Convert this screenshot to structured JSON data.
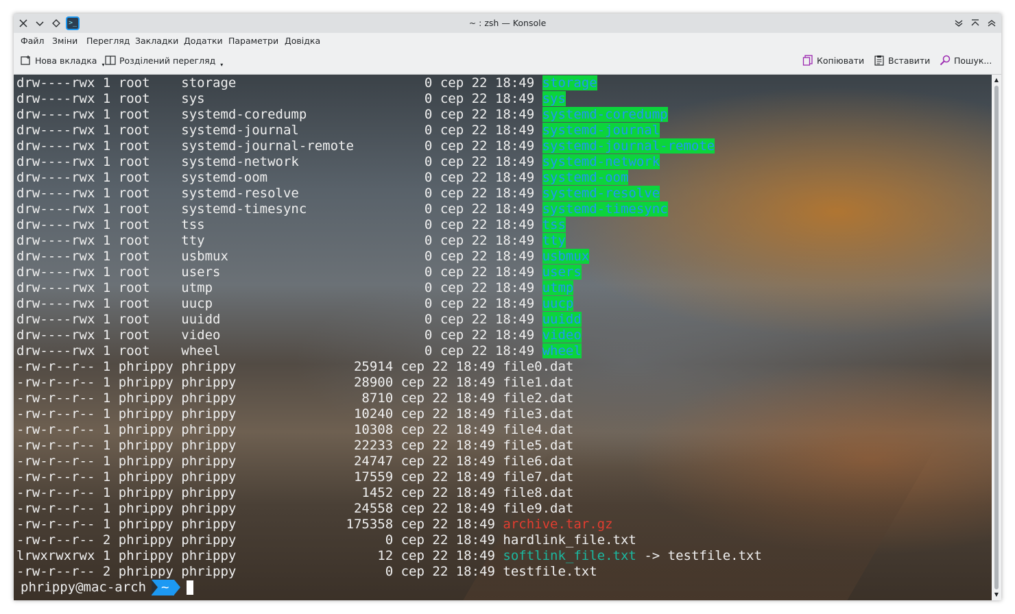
{
  "window": {
    "title": "~ : zsh — Konsole",
    "buttons": {
      "close": "✕",
      "menu": "⌄",
      "keep": "◇",
      "minimize": "⌄",
      "maximize": "⌃",
      "shade": "⌃"
    }
  },
  "menubar": [
    "Файл",
    "Зміни",
    "Перегляд",
    "Закладки",
    "Додатки",
    "Параметри",
    "Довідка"
  ],
  "toolbar": {
    "new_tab": "Нова вкладка",
    "split_view": "Розділений перегляд",
    "copy": "Копіювати",
    "paste": "Вставити",
    "search": "Пошук..."
  },
  "terminal": {
    "lines": [
      {
        "perm": "drw----rwx",
        "links": "1",
        "owner": "root",
        "group": "",
        "target": "storage",
        "size": "0",
        "month": "сер",
        "day": "22",
        "time": "18:49",
        "name": "storage"
      },
      {
        "perm": "drw----rwx",
        "links": "1",
        "owner": "root",
        "group": "",
        "target": "sys",
        "size": "0",
        "month": "сер",
        "day": "22",
        "time": "18:49",
        "name": "sys"
      },
      {
        "perm": "drw----rwx",
        "links": "1",
        "owner": "root",
        "group": "",
        "target": "systemd-coredump",
        "size": "0",
        "month": "сер",
        "day": "22",
        "time": "18:49",
        "name": "systemd-coredump"
      },
      {
        "perm": "drw----rwx",
        "links": "1",
        "owner": "root",
        "group": "",
        "target": "systemd-journal",
        "size": "0",
        "month": "сер",
        "day": "22",
        "time": "18:49",
        "name": "systemd-journal"
      },
      {
        "perm": "drw----rwx",
        "links": "1",
        "owner": "root",
        "group": "",
        "target": "systemd-journal-remote",
        "size": "0",
        "month": "сер",
        "day": "22",
        "time": "18:49",
        "name": "systemd-journal-remote"
      },
      {
        "perm": "drw----rwx",
        "links": "1",
        "owner": "root",
        "group": "",
        "target": "systemd-network",
        "size": "0",
        "month": "сер",
        "day": "22",
        "time": "18:49",
        "name": "systemd-network"
      },
      {
        "perm": "drw----rwx",
        "links": "1",
        "owner": "root",
        "group": "",
        "target": "systemd-oom",
        "size": "0",
        "month": "сер",
        "day": "22",
        "time": "18:49",
        "name": "systemd-oom"
      },
      {
        "perm": "drw----rwx",
        "links": "1",
        "owner": "root",
        "group": "",
        "target": "systemd-resolve",
        "size": "0",
        "month": "сер",
        "day": "22",
        "time": "18:49",
        "name": "systemd-resolve"
      },
      {
        "perm": "drw----rwx",
        "links": "1",
        "owner": "root",
        "group": "",
        "target": "systemd-timesync",
        "size": "0",
        "month": "сер",
        "day": "22",
        "time": "18:49",
        "name": "systemd-timesync"
      },
      {
        "perm": "drw----rwx",
        "links": "1",
        "owner": "root",
        "group": "",
        "target": "tss",
        "size": "0",
        "month": "сер",
        "day": "22",
        "time": "18:49",
        "name": "tss"
      },
      {
        "perm": "drw----rwx",
        "links": "1",
        "owner": "root",
        "group": "",
        "target": "tty",
        "size": "0",
        "month": "сер",
        "day": "22",
        "time": "18:49",
        "name": "tty"
      },
      {
        "perm": "drw----rwx",
        "links": "1",
        "owner": "root",
        "group": "",
        "target": "usbmux",
        "size": "0",
        "month": "сер",
        "day": "22",
        "time": "18:49",
        "name": "usbmux"
      },
      {
        "perm": "drw----rwx",
        "links": "1",
        "owner": "root",
        "group": "",
        "target": "users",
        "size": "0",
        "month": "сер",
        "day": "22",
        "time": "18:49",
        "name": "users"
      },
      {
        "perm": "drw----rwx",
        "links": "1",
        "owner": "root",
        "group": "",
        "target": "utmp",
        "size": "0",
        "month": "сер",
        "day": "22",
        "time": "18:49",
        "name": "utmp"
      },
      {
        "perm": "drw----rwx",
        "links": "1",
        "owner": "root",
        "group": "",
        "target": "uucp",
        "size": "0",
        "month": "сер",
        "day": "22",
        "time": "18:49",
        "name": "uucp"
      },
      {
        "perm": "drw----rwx",
        "links": "1",
        "owner": "root",
        "group": "",
        "target": "uuidd",
        "size": "0",
        "month": "сер",
        "day": "22",
        "time": "18:49",
        "name": "uuidd"
      },
      {
        "perm": "drw----rwx",
        "links": "1",
        "owner": "root",
        "group": "",
        "target": "video",
        "size": "0",
        "month": "сер",
        "day": "22",
        "time": "18:49",
        "name": "video"
      },
      {
        "perm": "drw----rwx",
        "links": "1",
        "owner": "root",
        "group": "",
        "target": "wheel",
        "size": "0",
        "month": "сер",
        "day": "22",
        "time": "18:49",
        "name": "wheel"
      },
      {
        "perm": "-rw-r--r--",
        "links": "1",
        "owner": "phrippy",
        "group": "phrippy",
        "size": "25914",
        "month": "сер",
        "day": "22",
        "time": "18:49",
        "name": "file0.dat"
      },
      {
        "perm": "-rw-r--r--",
        "links": "1",
        "owner": "phrippy",
        "group": "phrippy",
        "size": "28900",
        "month": "сер",
        "day": "22",
        "time": "18:49",
        "name": "file1.dat"
      },
      {
        "perm": "-rw-r--r--",
        "links": "1",
        "owner": "phrippy",
        "group": "phrippy",
        "size": "8710",
        "month": "сер",
        "day": "22",
        "time": "18:49",
        "name": "file2.dat"
      },
      {
        "perm": "-rw-r--r--",
        "links": "1",
        "owner": "phrippy",
        "group": "phrippy",
        "size": "10240",
        "month": "сер",
        "day": "22",
        "time": "18:49",
        "name": "file3.dat"
      },
      {
        "perm": "-rw-r--r--",
        "links": "1",
        "owner": "phrippy",
        "group": "phrippy",
        "size": "10308",
        "month": "сер",
        "day": "22",
        "time": "18:49",
        "name": "file4.dat"
      },
      {
        "perm": "-rw-r--r--",
        "links": "1",
        "owner": "phrippy",
        "group": "phrippy",
        "size": "22233",
        "month": "сер",
        "day": "22",
        "time": "18:49",
        "name": "file5.dat"
      },
      {
        "perm": "-rw-r--r--",
        "links": "1",
        "owner": "phrippy",
        "group": "phrippy",
        "size": "24747",
        "month": "сер",
        "day": "22",
        "time": "18:49",
        "name": "file6.dat"
      },
      {
        "perm": "-rw-r--r--",
        "links": "1",
        "owner": "phrippy",
        "group": "phrippy",
        "size": "17559",
        "month": "сер",
        "day": "22",
        "time": "18:49",
        "name": "file7.dat"
      },
      {
        "perm": "-rw-r--r--",
        "links": "1",
        "owner": "phrippy",
        "group": "phrippy",
        "size": "1452",
        "month": "сер",
        "day": "22",
        "time": "18:49",
        "name": "file8.dat"
      },
      {
        "perm": "-rw-r--r--",
        "links": "1",
        "owner": "phrippy",
        "group": "phrippy",
        "size": "24558",
        "month": "сер",
        "day": "22",
        "time": "18:49",
        "name": "file9.dat"
      },
      {
        "perm": "-rw-r--r--",
        "links": "1",
        "owner": "phrippy",
        "group": "phrippy",
        "size": "175358",
        "month": "сер",
        "day": "22",
        "time": "18:49",
        "name": "archive.tar.gz"
      },
      {
        "perm": "-rw-r--r--",
        "links": "2",
        "owner": "phrippy",
        "group": "phrippy",
        "size": "0",
        "month": "сер",
        "day": "22",
        "time": "18:49",
        "name": "hardlink_file.txt"
      },
      {
        "perm": "lrwxrwxrwx",
        "links": "1",
        "owner": "phrippy",
        "group": "phrippy",
        "size": "12",
        "month": "сер",
        "day": "22",
        "time": "18:49",
        "name": "softlink_file.txt",
        "link_target": "-> testfile.txt"
      },
      {
        "perm": "-rw-r--r--",
        "links": "2",
        "owner": "phrippy",
        "group": "phrippy",
        "size": "0",
        "month": "сер",
        "day": "22",
        "time": "18:49",
        "name": "testfile.txt"
      }
    ],
    "prompt": {
      "user_host": "phrippy@mac-arch",
      "path": "~"
    }
  },
  "colors": {
    "dir_bg": "#0cd43c",
    "dir_fg": "#2196f3",
    "archive": "#e33d30",
    "symlink": "#1bb8a0",
    "prompt_path_bg": "#1d99f3"
  }
}
